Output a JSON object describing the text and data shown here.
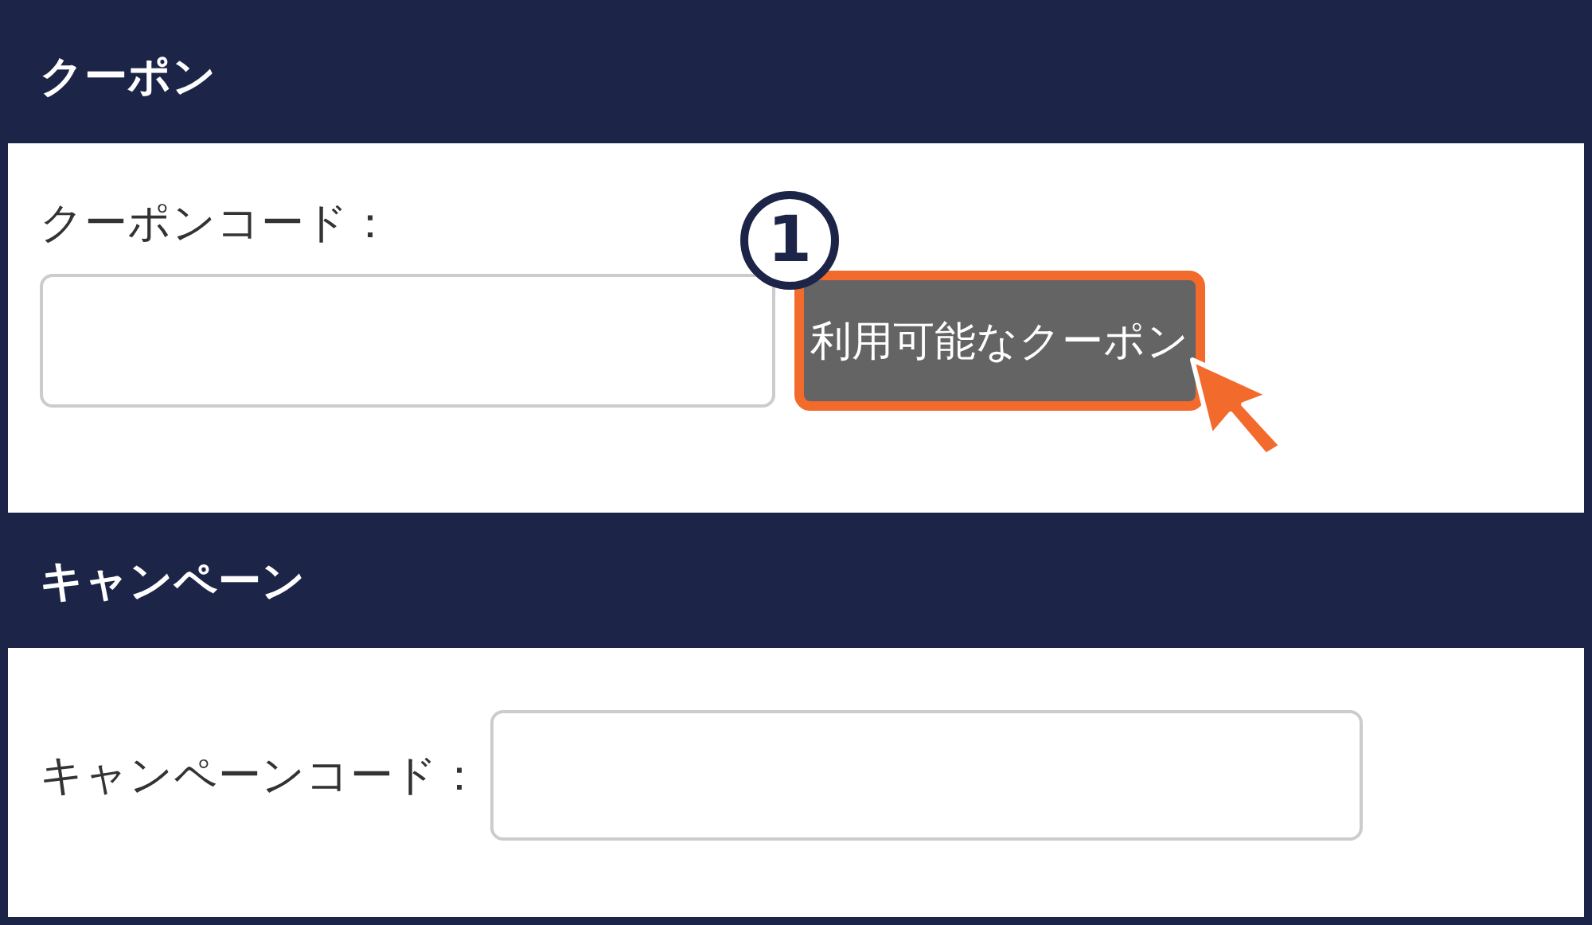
{
  "sections": [
    {
      "kind": "coupon",
      "title": "クーポン",
      "label": "クーポンコード：",
      "button": "利用可能なクーポン",
      "marker": "1"
    },
    {
      "kind": "campaign",
      "title": "キャンペーン",
      "label": "キャンペーンコード："
    }
  ]
}
